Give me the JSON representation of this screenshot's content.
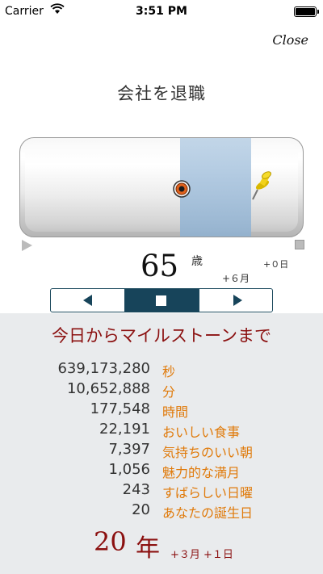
{
  "status_bar": {
    "carrier": "Carrier",
    "time": "3:51 PM"
  },
  "header": {
    "close_label": "Close",
    "title": "会社を退職"
  },
  "age": {
    "value": "65",
    "unit": "歳",
    "extra_months": "+６月",
    "extra_days": "+０日"
  },
  "stats_section": {
    "title": "今日からマイルストーンまで",
    "rows": [
      {
        "value": "639,173,280",
        "label": "秒"
      },
      {
        "value": "10,652,888",
        "label": "分"
      },
      {
        "value": "177,548",
        "label": "時間"
      },
      {
        "value": "22,191",
        "label": "おいしい食事"
      },
      {
        "value": "7,397",
        "label": "気持ちのいい朝"
      },
      {
        "value": "1,056",
        "label": "魅力的な満月"
      },
      {
        "value": "243",
        "label": "すばらしい日曜"
      },
      {
        "value": "20",
        "label": "あなたの誕生日"
      }
    ],
    "result": {
      "value": "20",
      "unit": "年",
      "extra": "+３月 +１日"
    }
  },
  "colors": {
    "accent_dark_red": "#8b1010",
    "label_orange": "#e07a0a",
    "control_navy": "#17445a",
    "band_blue": "#a9c4de"
  },
  "icons": [
    "wifi-icon",
    "battery-icon",
    "target-marker-icon",
    "pushpin-icon",
    "play-left-icon",
    "stop-icon",
    "play-right-icon"
  ]
}
